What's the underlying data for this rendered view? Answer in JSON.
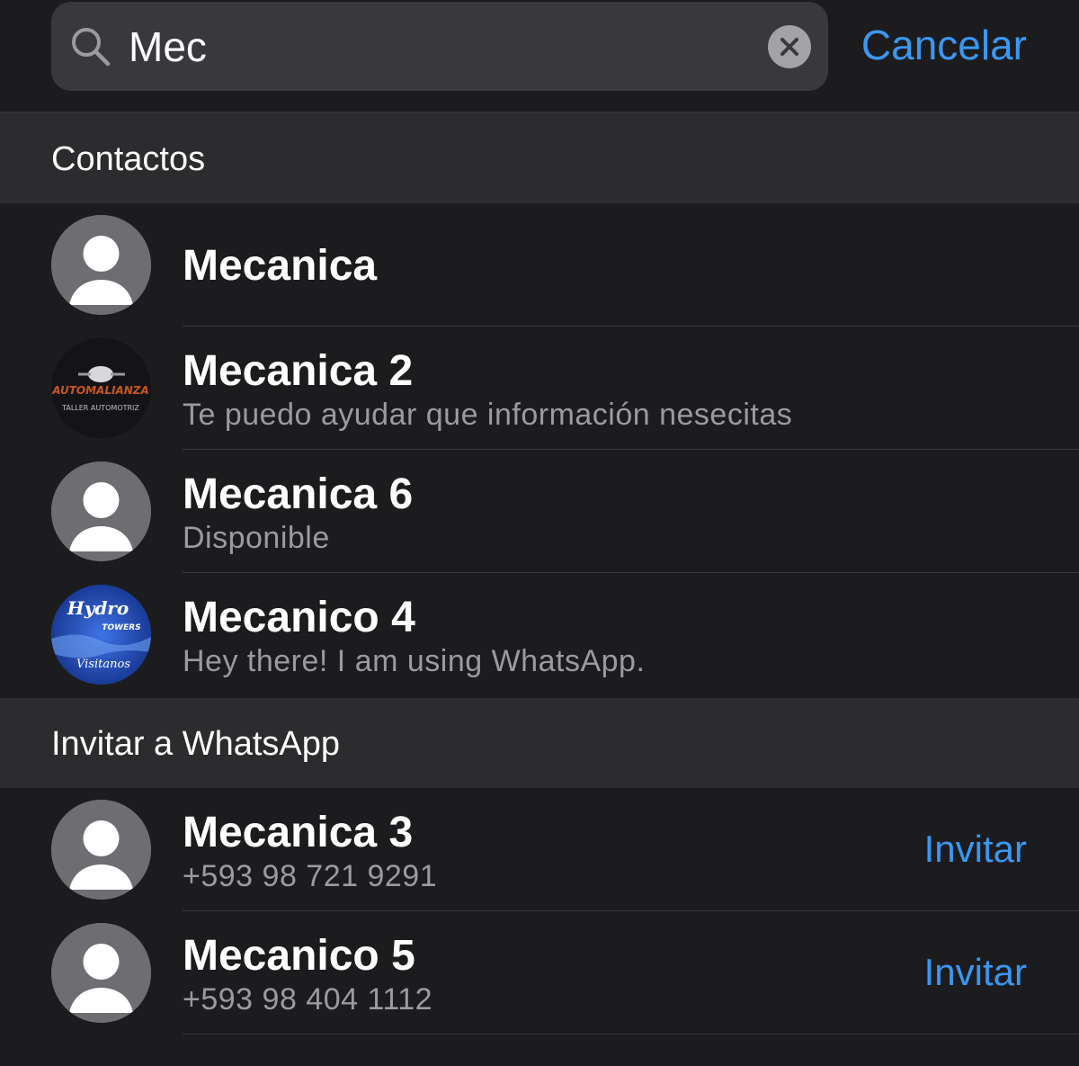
{
  "search": {
    "value": "Mec",
    "cancel_label": "Cancelar",
    "icon": "search-icon",
    "clear_icon": "clear-icon"
  },
  "sections": {
    "contacts": {
      "title": "Contactos",
      "items": [
        {
          "name": "Mecanica",
          "subtitle": "",
          "avatar": "default-avatar"
        },
        {
          "name": "Mecanica 2",
          "subtitle": "Te puedo ayudar que información nesecitas",
          "avatar": "photo-avatar-automalianza",
          "avatar_text": [
            "AUTOMALIANZA",
            "TALLER AUTOMOTRIZ"
          ]
        },
        {
          "name": "Mecanica 6",
          "subtitle": "Disponible",
          "avatar": "default-avatar"
        },
        {
          "name": "Mecanico 4",
          "subtitle": "Hey there! I am using WhatsApp.",
          "avatar": "photo-avatar-hydro",
          "avatar_text": [
            "Hydro",
            "TOWERS",
            "Visitanos"
          ]
        }
      ]
    },
    "invite": {
      "title": "Invitar a WhatsApp",
      "invite_label": "Invitar",
      "items": [
        {
          "name": "Mecanica 3",
          "subtitle": "+593 98 721 9291",
          "avatar": "default-avatar"
        },
        {
          "name": "Mecanico 5",
          "subtitle": "+593 98 404 1112",
          "avatar": "default-avatar"
        }
      ]
    }
  },
  "colors": {
    "background": "#1c1c1e",
    "section_header": "#2c2c2e",
    "search_field": "#39393d",
    "accent": "#3b97f0",
    "secondary_text": "#9a9aa0"
  }
}
